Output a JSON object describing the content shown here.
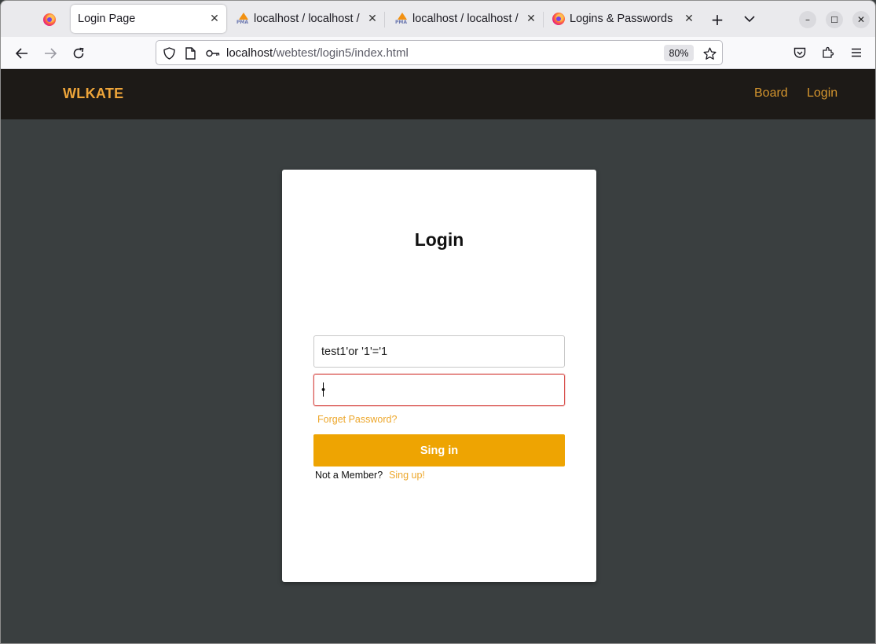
{
  "browser": {
    "tabs": [
      {
        "label": "Login Page",
        "favicon": "firefox-icon",
        "active": true
      },
      {
        "label": "localhost / localhost / ",
        "favicon": "phpmyadmin-icon",
        "active": false
      },
      {
        "label": "localhost / localhost / ",
        "favicon": "phpmyadmin-icon",
        "active": false
      },
      {
        "label": "Logins & Passwords",
        "favicon": "firefox-icon",
        "active": false
      }
    ],
    "url_host": "localhost",
    "url_path": "/webtest/login5/index.html",
    "zoom": "80%",
    "icons": {
      "new_tab": "+",
      "tab_list": "⌄",
      "minimize": "–",
      "maximize": "☐",
      "close": "✕",
      "tab_close": "✕"
    }
  },
  "site": {
    "brand": "WLKATE",
    "nav": [
      {
        "label": "Board"
      },
      {
        "label": "Login"
      }
    ]
  },
  "login": {
    "title": "Login",
    "username_value": "test1'or '1'='1",
    "password_value": "•",
    "forget_label": "Forget Password?",
    "signin_label": "Sing in",
    "member_text": "Not a Member?",
    "signup_label": "Sing up!"
  },
  "colors": {
    "accent": "#eea402",
    "brand": "#eea53a",
    "header_bg": "#1d1a17",
    "page_bg": "#3a3f40",
    "invalid_border": "#d9534f"
  }
}
